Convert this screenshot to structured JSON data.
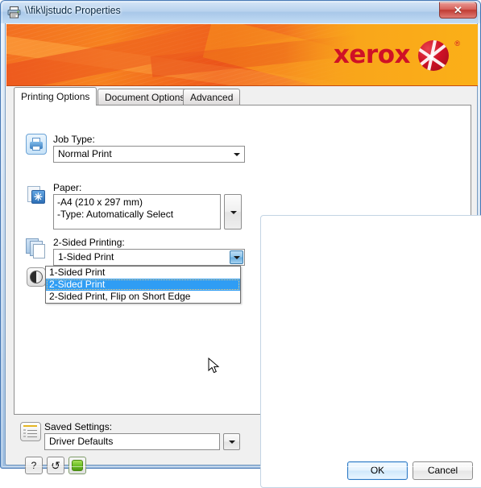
{
  "window": {
    "title": "\\\\fik\\ljstudc Properties",
    "title_icon": "printer-icon",
    "close_label": "✕"
  },
  "banner": {
    "brand": "xerox",
    "registered_mark": "®",
    "brand_color": "#cf1126",
    "background_color": "#f37021"
  },
  "tabs": [
    {
      "label": "Printing Options",
      "active": true
    },
    {
      "label": "Document Options",
      "active": false
    },
    {
      "label": "Advanced",
      "active": false
    }
  ],
  "printing_options": {
    "job_type": {
      "icon": "printer-icon",
      "label": "Job Type:",
      "value": "Normal Print"
    },
    "paper": {
      "icon": "paper-icon",
      "label": "Paper:",
      "line1": "-A4 (210 x 297 mm)",
      "line2": "-Type: Automatically Select"
    },
    "two_sided": {
      "icon": "two-sided-icon",
      "label": "2-Sided Printing:",
      "value": "1-Sided Print",
      "expanded": true,
      "options": [
        {
          "label": "1-Sided Print",
          "selected": false
        },
        {
          "label": "2-Sided Print",
          "selected": true
        },
        {
          "label": "2-Sided Print, Flip on Short Edge",
          "selected": false
        }
      ]
    },
    "output": {
      "icon": "output-circle-icon"
    }
  },
  "saved_settings": {
    "icon": "saved-settings-icon",
    "label": "Saved Settings:",
    "value": "Driver Defaults"
  },
  "footer": {
    "help_label": "?",
    "reset_label": "↺",
    "status_label": "",
    "ok_label": "OK",
    "cancel_label": "Cancel"
  }
}
